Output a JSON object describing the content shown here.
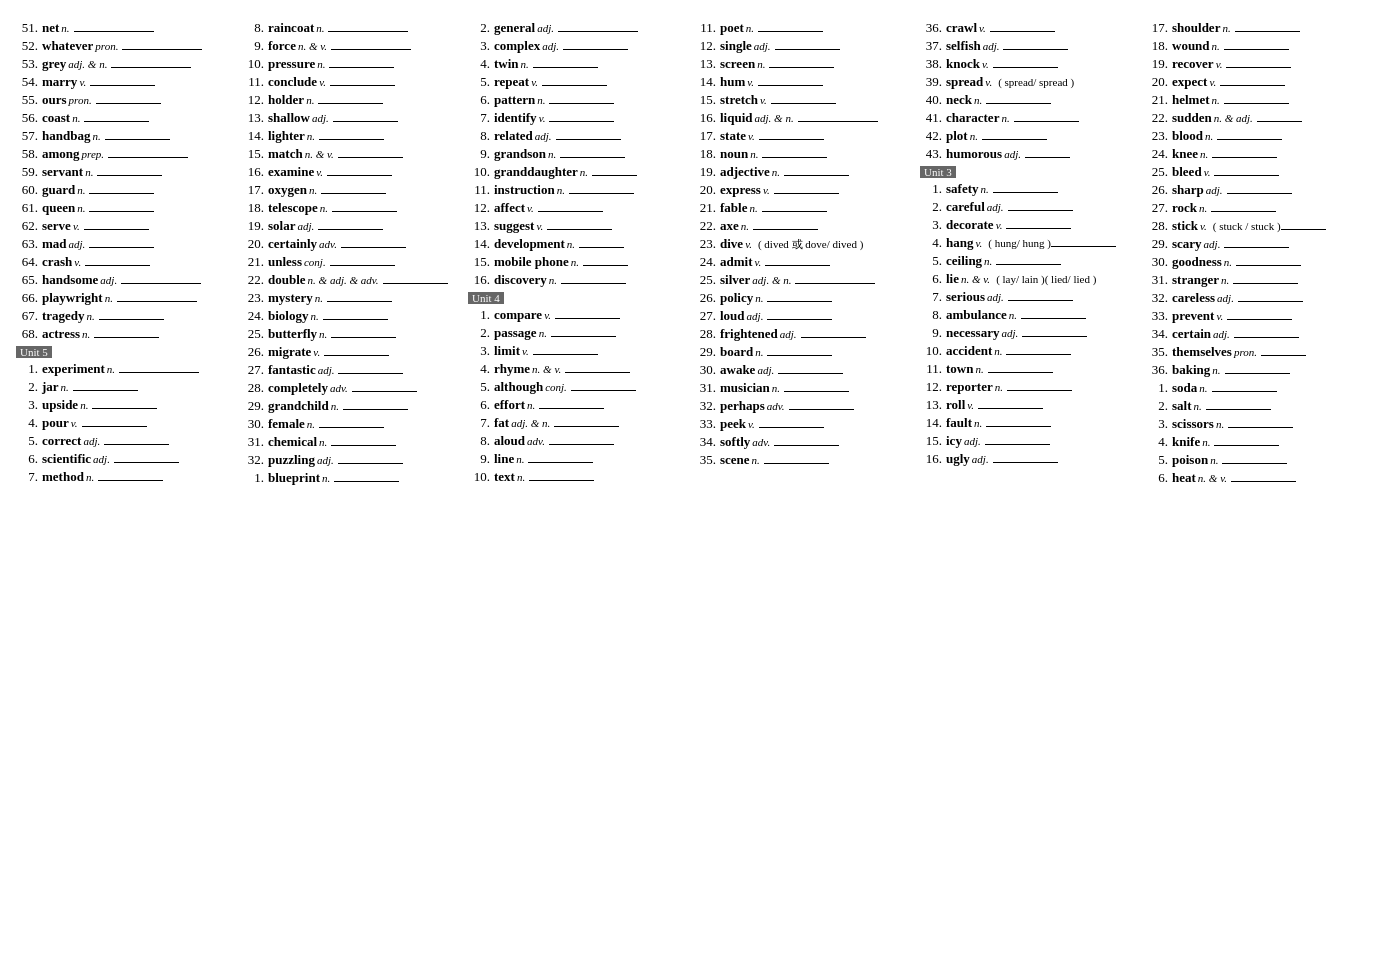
{
  "columns": [
    {
      "id": "col1",
      "entries": [
        {
          "num": "51.",
          "word": "net",
          "pos": "n.",
          "line": "med"
        },
        {
          "num": "52.",
          "word": "whatever",
          "pos": "pron.",
          "line": "med"
        },
        {
          "num": "53.",
          "word": "grey",
          "pos": "adj. & n.",
          "line": "med"
        },
        {
          "num": "54.",
          "word": "marry",
          "pos": "v.",
          "line": "short"
        },
        {
          "num": "55.",
          "word": "ours",
          "pos": "pron.",
          "line": "short"
        },
        {
          "num": "56.",
          "word": "coast",
          "pos": "n.",
          "line": "short"
        },
        {
          "num": "57.",
          "word": "handbag",
          "pos": "n.",
          "line": "short"
        },
        {
          "num": "58.",
          "word": "among",
          "pos": "prep.",
          "line": "med"
        },
        {
          "num": "59.",
          "word": "servant",
          "pos": "n.",
          "line": "short"
        },
        {
          "num": "60.",
          "word": "guard",
          "pos": "n.",
          "line": "short"
        },
        {
          "num": "61.",
          "word": "queen",
          "pos": "n.",
          "line": "short"
        },
        {
          "num": "62.",
          "word": "serve",
          "pos": "v.",
          "line": "short"
        },
        {
          "num": "63.",
          "word": "mad",
          "pos": "adj.",
          "line": "short"
        },
        {
          "num": "64.",
          "word": "crash",
          "pos": "v.",
          "line": "short"
        },
        {
          "num": "65.",
          "word": "handsome",
          "pos": "adj.",
          "line": "med"
        },
        {
          "num": "66.",
          "word": "playwright",
          "pos": "n.",
          "line": "med"
        },
        {
          "num": "67.",
          "word": "tragedy",
          "pos": "n.",
          "line": "short"
        },
        {
          "num": "68.",
          "word": "actress",
          "pos": "n.",
          "line": "short"
        },
        {
          "num": "unit",
          "label": "Unit 5"
        },
        {
          "num": "1.",
          "word": "experiment",
          "pos": "n.",
          "line": "med"
        },
        {
          "num": "2.",
          "word": "jar",
          "pos": "n.",
          "line": "short"
        },
        {
          "num": "3.",
          "word": "upside",
          "pos": "n.",
          "line": "short"
        },
        {
          "num": "4.",
          "word": "pour",
          "pos": "v.",
          "line": "short"
        },
        {
          "num": "5.",
          "word": "correct",
          "pos": "adj.",
          "line": "short"
        },
        {
          "num": "6.",
          "word": "scientific",
          "pos": "adj.",
          "line": "short"
        },
        {
          "num": "7.",
          "word": "method",
          "pos": "n.",
          "line": "short"
        }
      ]
    },
    {
      "id": "col2",
      "entries": [
        {
          "num": "8.",
          "word": "raincoat",
          "pos": "n.",
          "line": "med"
        },
        {
          "num": "9.",
          "word": "force",
          "pos": "n. & v.",
          "line": "med"
        },
        {
          "num": "10.",
          "word": "pressure",
          "pos": "n.",
          "line": "short"
        },
        {
          "num": "11.",
          "word": "conclude",
          "pos": "v.",
          "line": "short"
        },
        {
          "num": "12.",
          "word": "holder",
          "pos": "n.",
          "line": "short"
        },
        {
          "num": "13.",
          "word": "shallow",
          "pos": "adj.",
          "line": "short"
        },
        {
          "num": "14.",
          "word": "lighter",
          "pos": "n.",
          "line": "short"
        },
        {
          "num": "15.",
          "word": "match",
          "pos": "n. & v.",
          "line": "short"
        },
        {
          "num": "16.",
          "word": "examine",
          "pos": "v.",
          "line": "short"
        },
        {
          "num": "17.",
          "word": "oxygen",
          "pos": "n.",
          "line": "short"
        },
        {
          "num": "18.",
          "word": "telescope",
          "pos": "n.",
          "line": "short"
        },
        {
          "num": "19.",
          "word": "solar",
          "pos": "adj.",
          "line": "short"
        },
        {
          "num": "20.",
          "word": "certainly",
          "pos": "adv.",
          "line": "short"
        },
        {
          "num": "21.",
          "word": "unless",
          "pos": "conj.",
          "line": "short"
        },
        {
          "num": "22.",
          "word": "double",
          "pos": "n. & adj. & adv.",
          "line": "short"
        },
        {
          "num": "23.",
          "word": "mystery",
          "pos": "n.",
          "line": "short"
        },
        {
          "num": "24.",
          "word": "biology",
          "pos": "n.",
          "line": "short"
        },
        {
          "num": "25.",
          "word": "butterfly",
          "pos": "n.",
          "line": "short"
        },
        {
          "num": "26.",
          "word": "migrate",
          "pos": "v.",
          "line": "short"
        },
        {
          "num": "27.",
          "word": "fantastic",
          "pos": "adj.",
          "line": "short"
        },
        {
          "num": "28.",
          "word": "completely",
          "pos": "adv.",
          "line": "short"
        },
        {
          "num": "29.",
          "word": "grandchild",
          "pos": "n.",
          "line": "short"
        },
        {
          "num": "30.",
          "word": "female",
          "pos": "n.",
          "line": "short"
        },
        {
          "num": "31.",
          "word": "chemical",
          "pos": "n.",
          "line": "short"
        },
        {
          "num": "32.",
          "word": "puzzling",
          "pos": "adj.",
          "line": "short"
        },
        {
          "num": "1.",
          "word": "blueprint",
          "pos": "n.",
          "line": "short"
        }
      ]
    },
    {
      "id": "col3",
      "entries": [
        {
          "num": "2.",
          "word": "general",
          "pos": "adj.",
          "line": "med"
        },
        {
          "num": "3.",
          "word": "complex",
          "pos": "adj.",
          "line": "short"
        },
        {
          "num": "4.",
          "word": "twin",
          "pos": "n.",
          "line": "short"
        },
        {
          "num": "5.",
          "word": "repeat",
          "pos": "v.",
          "line": "short"
        },
        {
          "num": "6.",
          "word": "pattern",
          "pos": "n.",
          "line": "short"
        },
        {
          "num": "7.",
          "word": "identify",
          "pos": "v.",
          "line": "short"
        },
        {
          "num": "8.",
          "word": "related",
          "pos": "adj.",
          "line": "short"
        },
        {
          "num": "9.",
          "word": "grandson",
          "pos": "n.",
          "line": "short"
        },
        {
          "num": "10.",
          "word": "granddaughter",
          "pos": "n.",
          "line": "vshort"
        },
        {
          "num": "11.",
          "word": "instruction",
          "pos": "n.",
          "line": "short"
        },
        {
          "num": "12.",
          "word": "affect",
          "pos": "v.",
          "line": "short"
        },
        {
          "num": "13.",
          "word": "suggest",
          "pos": "v.",
          "line": "short"
        },
        {
          "num": "14.",
          "word": "development",
          "pos": "n.",
          "line": "vshort"
        },
        {
          "num": "15.",
          "word": "mobile phone",
          "pos": "n.",
          "line": "vshort"
        },
        {
          "num": "16.",
          "word": "discovery",
          "pos": "n.",
          "line": "short"
        },
        {
          "num": "unit",
          "label": "Unit 4"
        },
        {
          "num": "1.",
          "word": "compare",
          "pos": "v.",
          "line": "short"
        },
        {
          "num": "2.",
          "word": "passage",
          "pos": "n.",
          "line": "short"
        },
        {
          "num": "3.",
          "word": "limit",
          "pos": "v.",
          "line": "short"
        },
        {
          "num": "4.",
          "word": "rhyme",
          "pos": "n. & v.",
          "line": "short"
        },
        {
          "num": "5.",
          "word": "although",
          "pos": "conj.",
          "line": "short"
        },
        {
          "num": "6.",
          "word": "effort",
          "pos": "n.",
          "line": "short"
        },
        {
          "num": "7.",
          "word": "fat",
          "pos": "adj. & n.",
          "line": "short"
        },
        {
          "num": "8.",
          "word": "aloud",
          "pos": "adv.",
          "line": "short"
        },
        {
          "num": "9.",
          "word": "line",
          "pos": "n.",
          "line": "short"
        },
        {
          "num": "10.",
          "word": "text",
          "pos": "n.",
          "line": "short"
        }
      ]
    },
    {
      "id": "col4",
      "entries": [
        {
          "num": "11.",
          "word": "poet",
          "pos": "n.",
          "line": "short"
        },
        {
          "num": "12.",
          "word": "single",
          "pos": "adj.",
          "line": "short"
        },
        {
          "num": "13.",
          "word": "screen",
          "pos": "n.",
          "line": "short"
        },
        {
          "num": "14.",
          "word": "hum",
          "pos": "v.",
          "line": "short"
        },
        {
          "num": "15.",
          "word": "stretch",
          "pos": "v.",
          "line": "short"
        },
        {
          "num": "16.",
          "word": "liquid",
          "pos": "adj. & n.",
          "line": "med"
        },
        {
          "num": "17.",
          "word": "state",
          "pos": "v.",
          "line": "short"
        },
        {
          "num": "18.",
          "word": "noun",
          "pos": "n.",
          "line": "short"
        },
        {
          "num": "19.",
          "word": "adjective",
          "pos": "n.",
          "line": "short"
        },
        {
          "num": "20.",
          "word": "express",
          "pos": "v.",
          "line": "short"
        },
        {
          "num": "21.",
          "word": "fable",
          "pos": "n.",
          "line": "short"
        },
        {
          "num": "22.",
          "word": "axe",
          "pos": "n.",
          "line": "short"
        },
        {
          "num": "23.",
          "word": "dive",
          "pos": "v.",
          "note": "( dived 或 dove/ dived )",
          "line": ""
        },
        {
          "num": "24.",
          "word": "admit",
          "pos": "v.",
          "line": "short"
        },
        {
          "num": "25.",
          "word": "silver",
          "pos": "adj. & n.",
          "line": "med"
        },
        {
          "num": "26.",
          "word": "policy",
          "pos": "n.",
          "line": "short"
        },
        {
          "num": "27.",
          "word": "loud",
          "pos": "adj.",
          "line": "short"
        },
        {
          "num": "28.",
          "word": "frightened",
          "pos": "adj.",
          "line": "short"
        },
        {
          "num": "29.",
          "word": "board",
          "pos": "n.",
          "line": "short"
        },
        {
          "num": "30.",
          "word": "awake",
          "pos": "adj.",
          "line": "short"
        },
        {
          "num": "31.",
          "word": "musician",
          "pos": "n.",
          "line": "short"
        },
        {
          "num": "32.",
          "word": "perhaps",
          "pos": "adv.",
          "line": "short"
        },
        {
          "num": "33.",
          "word": "peek",
          "pos": "v.",
          "line": "short"
        },
        {
          "num": "34.",
          "word": "softly",
          "pos": "adv.",
          "line": "short"
        },
        {
          "num": "35.",
          "word": "scene",
          "pos": "n.",
          "line": "short"
        }
      ]
    },
    {
      "id": "col5",
      "entries": [
        {
          "num": "36.",
          "word": "crawl",
          "pos": "v.",
          "line": "short"
        },
        {
          "num": "37.",
          "word": "selfish",
          "pos": "adj.",
          "line": "short"
        },
        {
          "num": "38.",
          "word": "knock",
          "pos": "v.",
          "line": "short"
        },
        {
          "num": "39.",
          "word": "spread",
          "pos": "v.",
          "note": "( spread/ spread )",
          "line": ""
        },
        {
          "num": "40.",
          "word": "neck",
          "pos": "n.",
          "line": "short"
        },
        {
          "num": "41.",
          "word": "character",
          "pos": "n.",
          "line": "short"
        },
        {
          "num": "42.",
          "word": "plot",
          "pos": "n.",
          "line": "short"
        },
        {
          "num": "43.",
          "word": "humorous",
          "pos": "adj.",
          "line": "vshort"
        },
        {
          "num": "unit",
          "label": "Unit 3"
        },
        {
          "num": "1.",
          "word": "safety",
          "pos": "n.",
          "line": "short"
        },
        {
          "num": "2.",
          "word": "careful",
          "pos": "adj.",
          "line": "short"
        },
        {
          "num": "3.",
          "word": "decorate",
          "pos": "v.",
          "line": "short"
        },
        {
          "num": "4.",
          "word": "hang",
          "pos": "v.",
          "note": "( hung/ hung )",
          "line": "short"
        },
        {
          "num": "5.",
          "word": "ceiling",
          "pos": "n.",
          "line": "short"
        },
        {
          "num": "6.",
          "word": "lie",
          "pos": "n. & v.",
          "note": "( lay/ lain )( lied/ lied )",
          "line": ""
        },
        {
          "num": "7.",
          "word": "serious",
          "pos": "adj.",
          "line": "short"
        },
        {
          "num": "8.",
          "word": "ambulance",
          "pos": "n.",
          "line": "short"
        },
        {
          "num": "9.",
          "word": "necessary",
          "pos": "adj.",
          "line": "short"
        },
        {
          "num": "10.",
          "word": "accident",
          "pos": "n.",
          "line": "short"
        },
        {
          "num": "11.",
          "word": "town",
          "pos": "n.",
          "line": "short"
        },
        {
          "num": "12.",
          "word": "reporter",
          "pos": "n.",
          "line": "short"
        },
        {
          "num": "13.",
          "word": "roll",
          "pos": "v.",
          "line": "short"
        },
        {
          "num": "14.",
          "word": "fault",
          "pos": "n.",
          "line": "short"
        },
        {
          "num": "15.",
          "word": "icy",
          "pos": "adj.",
          "line": "short"
        },
        {
          "num": "16.",
          "word": "ugly",
          "pos": "adj.",
          "line": "short"
        }
      ]
    },
    {
      "id": "col6",
      "entries": [
        {
          "num": "17.",
          "word": "shoulder",
          "pos": "n.",
          "line": "short"
        },
        {
          "num": "18.",
          "word": "wound",
          "pos": "n.",
          "line": "short"
        },
        {
          "num": "19.",
          "word": "recover",
          "pos": "v.",
          "line": "short"
        },
        {
          "num": "20.",
          "word": "expect",
          "pos": "v.",
          "line": "short"
        },
        {
          "num": "21.",
          "word": "helmet",
          "pos": "n.",
          "line": "short"
        },
        {
          "num": "22.",
          "word": "sudden",
          "pos": "n. & adj.",
          "line": "vshort"
        },
        {
          "num": "23.",
          "word": "blood",
          "pos": "n.",
          "line": "short"
        },
        {
          "num": "24.",
          "word": "knee",
          "pos": "n.",
          "line": "short"
        },
        {
          "num": "25.",
          "word": "bleed",
          "pos": "v.",
          "line": "short"
        },
        {
          "num": "26.",
          "word": "sharp",
          "pos": "adj.",
          "line": "short"
        },
        {
          "num": "27.",
          "word": "rock",
          "pos": "n.",
          "line": "short"
        },
        {
          "num": "28.",
          "word": "stick",
          "pos": "v.",
          "note": "( stuck / stuck )",
          "line": "vshort"
        },
        {
          "num": "29.",
          "word": "scary",
          "pos": "adj.",
          "line": "short"
        },
        {
          "num": "30.",
          "word": "goodness",
          "pos": "n.",
          "line": "short"
        },
        {
          "num": "31.",
          "word": "stranger",
          "pos": "n.",
          "line": "short"
        },
        {
          "num": "32.",
          "word": "careless",
          "pos": "adj.",
          "line": "short"
        },
        {
          "num": "33.",
          "word": "prevent",
          "pos": "v.",
          "line": "short"
        },
        {
          "num": "34.",
          "word": "certain",
          "pos": "adj.",
          "line": "short"
        },
        {
          "num": "35.",
          "word": "themselves",
          "pos": "pron.",
          "line": "vshort"
        },
        {
          "num": "36.",
          "word": "baking",
          "pos": "n.",
          "line": "short"
        },
        {
          "num": "1.",
          "word": "soda",
          "pos": "n.",
          "line": "short"
        },
        {
          "num": "2.",
          "word": "salt",
          "pos": "n.",
          "line": "short"
        },
        {
          "num": "3.",
          "word": "scissors",
          "pos": "n.",
          "line": "short"
        },
        {
          "num": "4.",
          "word": "knife",
          "pos": "n.",
          "line": "short"
        },
        {
          "num": "5.",
          "word": "poison",
          "pos": "n.",
          "line": "short"
        },
        {
          "num": "6.",
          "word": "heat",
          "pos": "n. & v.",
          "line": "short"
        }
      ]
    }
  ]
}
